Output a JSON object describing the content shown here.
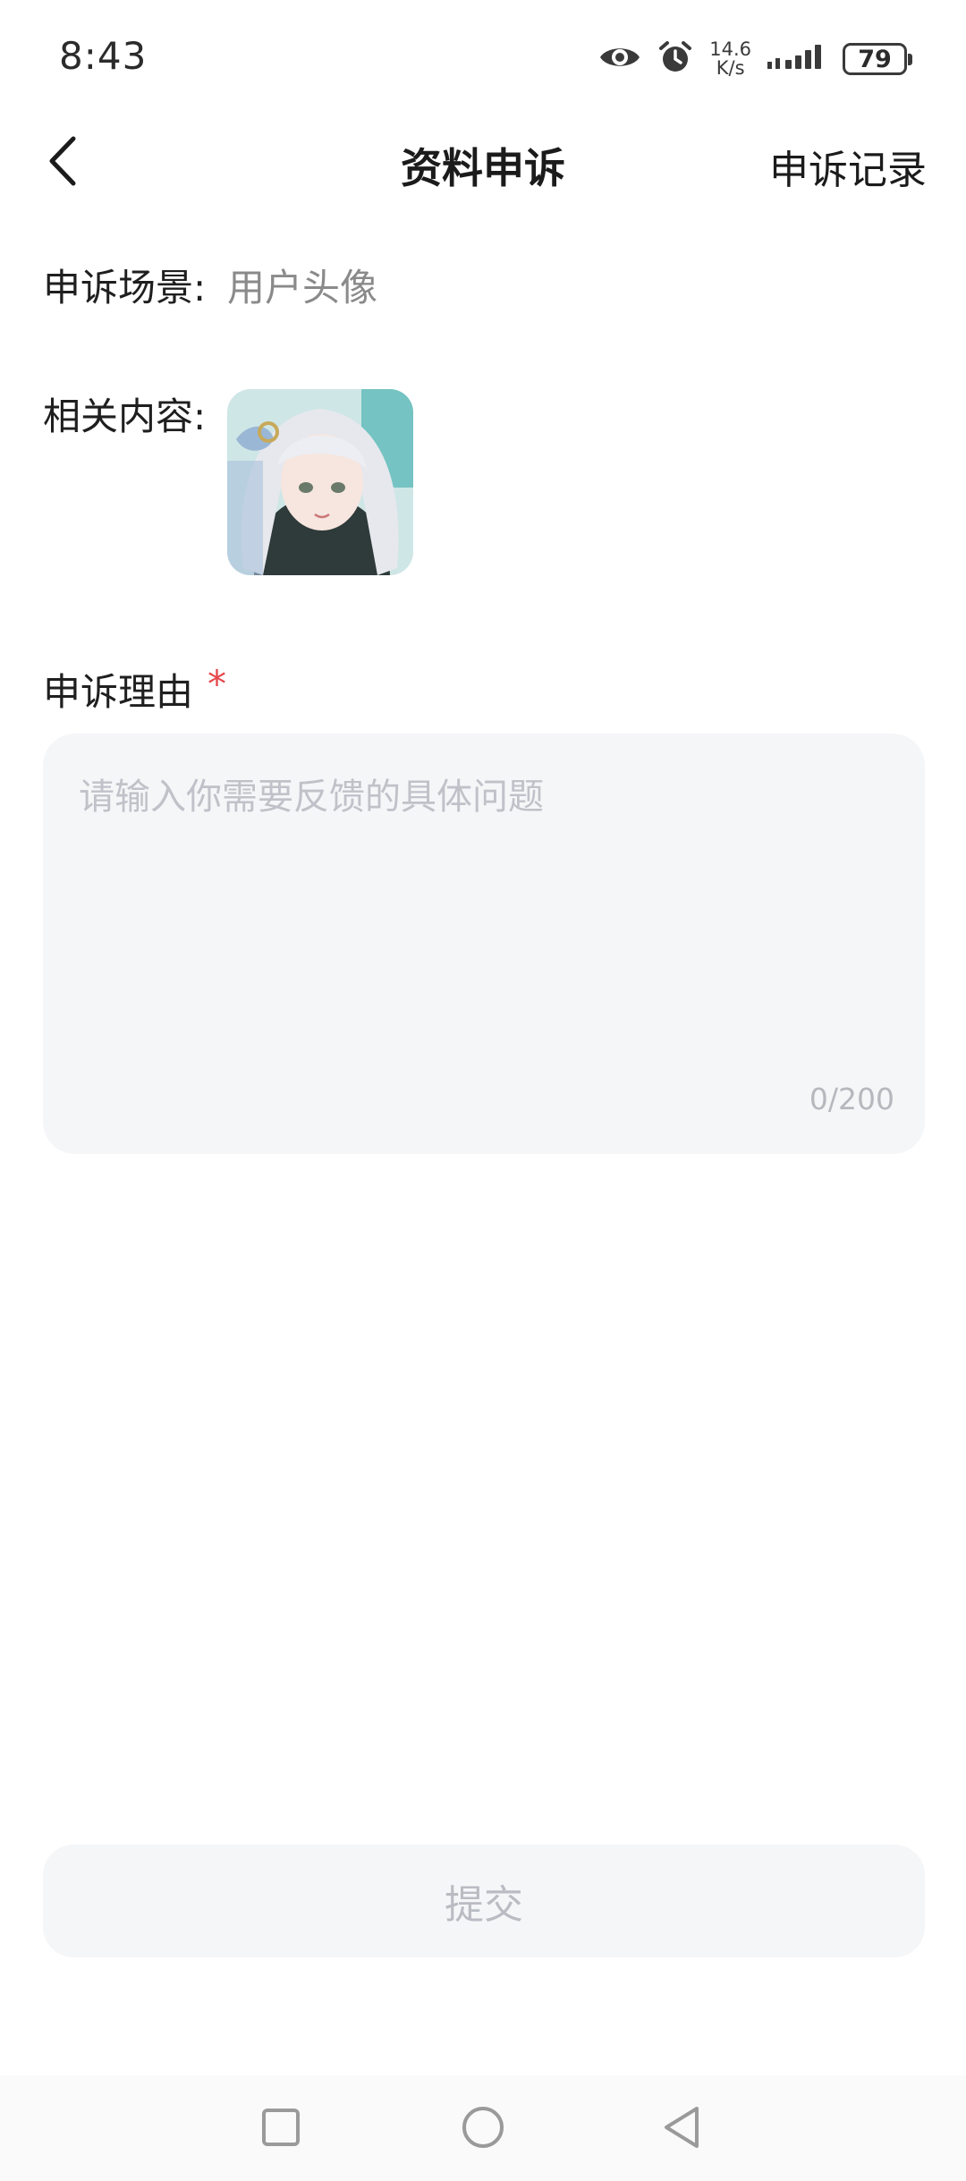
{
  "status_bar": {
    "time": "8:43",
    "net_speed_value": "14.6",
    "net_speed_unit": "K/s",
    "battery": "79",
    "icons": [
      "eye-icon",
      "alarm-icon",
      "signal-icon",
      "battery-icon"
    ]
  },
  "header": {
    "back_icon": "chevron-left-icon",
    "title": "资料申诉",
    "records_label": "申诉记录"
  },
  "form": {
    "scene_label": "申诉场景:",
    "scene_value": "用户头像",
    "content_label": "相关内容:",
    "reason_label": "申诉理由",
    "required_mark": "*",
    "reason_placeholder": "请输入你需要反馈的具体问题",
    "reason_counter": "0/200"
  },
  "submit": {
    "label": "提交"
  },
  "nav": {
    "icons": [
      "square-icon",
      "circle-icon",
      "triangle-back-icon"
    ]
  },
  "colors": {
    "background": "#ffffff",
    "input_bg": "#f5f6f8",
    "placeholder": "#bfc2c8",
    "required": "#e5484d",
    "text_primary": "#1f1f1f",
    "text_secondary": "#8a8a8a"
  }
}
